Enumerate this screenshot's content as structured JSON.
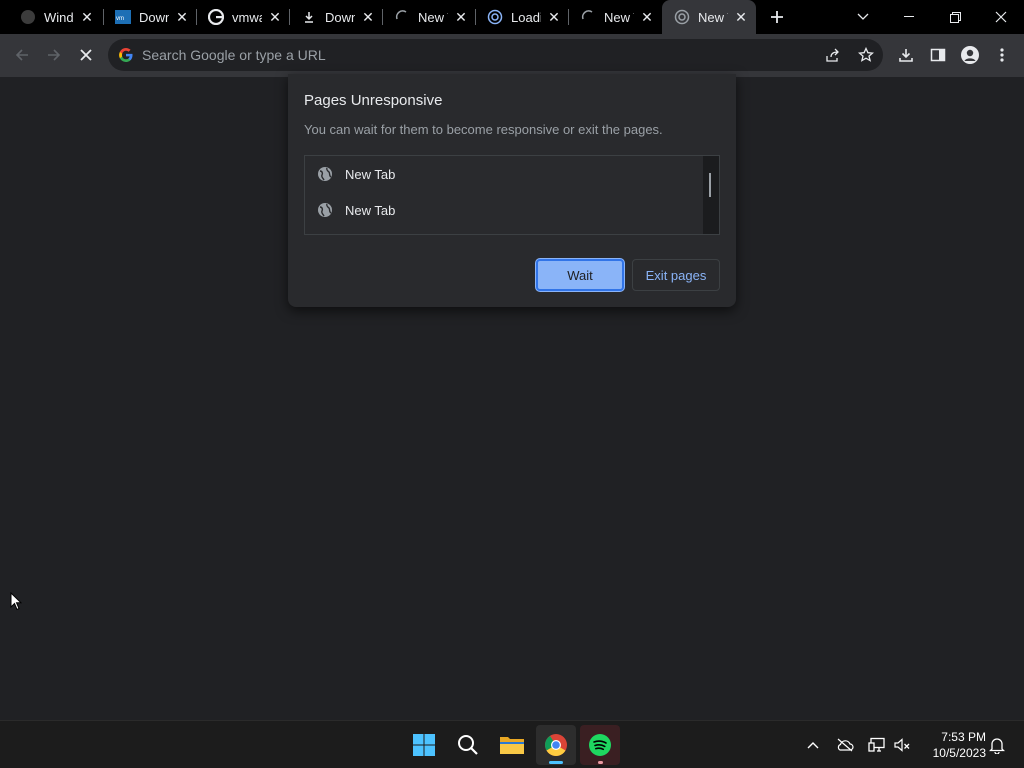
{
  "browser": {
    "tabs": [
      {
        "title": "Windows",
        "favicon": "github-icon"
      },
      {
        "title": "Download",
        "favicon": "vmware-icon"
      },
      {
        "title": "vmware",
        "favicon": "google-icon"
      },
      {
        "title": "Download",
        "favicon": "download-icon"
      },
      {
        "title": "New Tab",
        "favicon": "loading-spinner-icon"
      },
      {
        "title": "Loading",
        "favicon": "loading-page-icon"
      },
      {
        "title": "New Tab",
        "favicon": "loading-spinner-icon"
      },
      {
        "title": "New Tab",
        "favicon": "loading-page-icon",
        "active": true
      }
    ],
    "omnibox": {
      "placeholder": "Search Google or type a URL"
    }
  },
  "dialog": {
    "title": "Pages Unresponsive",
    "message": "You can wait for them to become responsive or exit the pages.",
    "pages": [
      "New Tab",
      "New Tab"
    ],
    "wait_label": "Wait",
    "exit_label": "Exit pages"
  },
  "taskbar": {
    "time": "7:53 PM",
    "date": "10/5/2023"
  },
  "colors": {
    "accent": "#8ab4f8",
    "background": "#202124",
    "toolbar": "#35363a",
    "dialog": "#292a2d"
  }
}
